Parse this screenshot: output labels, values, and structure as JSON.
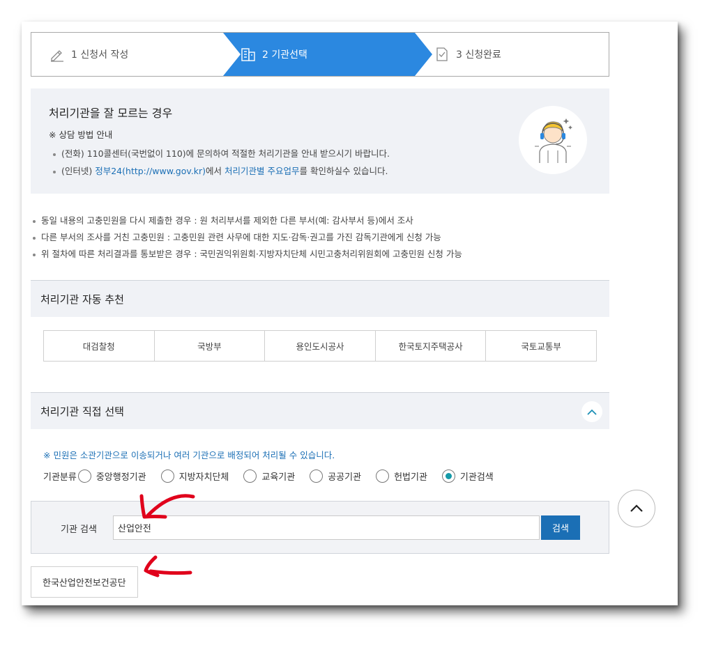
{
  "steps": [
    {
      "label": "1 신청서 작성",
      "icon": "pencil-icon"
    },
    {
      "label": "2 기관선택",
      "icon": "building-icon",
      "active": true
    },
    {
      "label": "3 신청완료",
      "icon": "check-document-icon"
    }
  ],
  "guide": {
    "title": "처리기관을 잘 모르는 경우",
    "subtitle": "※ 상담 방법 안내",
    "phone_line": "(전화) 110콜센터(국번없이 110)에 문의하여 적절한 처리기관을 안내 받으시기 바랍니다.",
    "web_prefix": "(인터넷) ",
    "web_link1": "정부24(http://www.gov.kr)",
    "web_middle": "에서 ",
    "web_link2": "처리기관별 주요업무",
    "web_suffix": "를 확인하실수 있습니다."
  },
  "bullets": [
    "동일 내용의 고충민원을 다시 제출한 경우 : 원 처리부서를 제외한 다른 부서(예: 감사부서 등)에서 조사",
    "다른 부서의 조사를 거친 고충민원 : 고충민원 관련 사무에 대한 지도·감독·권고를 가진 감독기관에게 신청 가능",
    "위 절차에 따른 처리결과를 통보받은 경우 : 국민권익위원회·지방자치단체 시민고충처리위원회에 고충민원 신청 가능"
  ],
  "auto": {
    "title": "처리기관 자동 추천",
    "agencies": [
      "대검찰청",
      "국방부",
      "용인도시공사",
      "한국토지주택공사",
      "국토교통부"
    ]
  },
  "direct": {
    "title": "처리기관 직접 선택",
    "notice": "※ 민원은 소관기관으로 이송되거나 여러 기관으로 배정되어 처리될 수 있습니다.",
    "category_label": "기관분류",
    "categories": [
      "중앙행정기관",
      "지방자치단체",
      "교육기관",
      "공공기관",
      "헌법기관",
      "기관검색"
    ],
    "selected_category": "기관검색"
  },
  "search": {
    "label": "기관 검색",
    "value": "산업안전",
    "button": "검색"
  },
  "result": "한국산업안전보건공단",
  "colors": {
    "accent": "#2b88e0",
    "link": "#1b6fb5",
    "radio_on": "#159aa8",
    "annotation": "#e0001b"
  }
}
